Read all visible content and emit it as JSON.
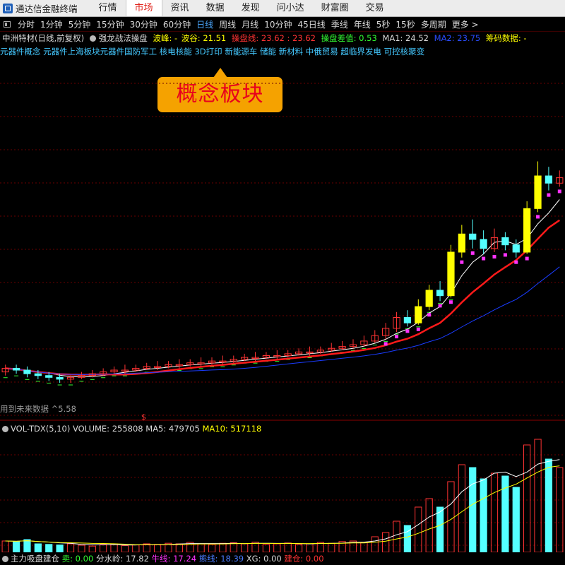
{
  "app": {
    "title": "通达信金融终端"
  },
  "menu": [
    {
      "label": "行情",
      "active": false
    },
    {
      "label": "市场",
      "active": true
    },
    {
      "label": "资讯",
      "active": false
    },
    {
      "label": "数据",
      "active": false
    },
    {
      "label": "发现",
      "active": false
    },
    {
      "label": "问小达",
      "active": false
    },
    {
      "label": "财富圈",
      "active": false
    },
    {
      "label": "交易",
      "active": false
    }
  ],
  "periods": [
    {
      "label": "分时",
      "selected": false
    },
    {
      "label": "1分钟",
      "selected": false
    },
    {
      "label": "5分钟",
      "selected": false
    },
    {
      "label": "15分钟",
      "selected": false
    },
    {
      "label": "30分钟",
      "selected": false
    },
    {
      "label": "60分钟",
      "selected": false
    },
    {
      "label": "日线",
      "selected": true
    },
    {
      "label": "周线",
      "selected": false
    },
    {
      "label": "月线",
      "selected": false
    },
    {
      "label": "10分钟",
      "selected": false
    },
    {
      "label": "45日线",
      "selected": false
    },
    {
      "label": "季线",
      "selected": false
    },
    {
      "label": "年线",
      "selected": false
    },
    {
      "label": "5秒",
      "selected": false
    },
    {
      "label": "15秒",
      "selected": false
    },
    {
      "label": "多周期",
      "selected": false
    },
    {
      "label": "更多 >",
      "selected": false
    }
  ],
  "info": {
    "stock": "中洲特材(日线,前复权)",
    "indicator": "强龙战法操盘",
    "wave_label": "波峰: -",
    "wave_value": "波谷: 21.51",
    "cp_line": "操盘线: 23.62 : 23.62",
    "cp_diff": "操盘差值: 0.53",
    "ma1": "MA1: 24.52",
    "ma2": "MA2: 23.75",
    "chip": "筹码数据: -"
  },
  "concepts": "元器件概念 元器件上海板块元器件国防军工 核电核能 3D打印 新能源车 储能 新材料 中俄贸易 超临界发电 可控核聚变",
  "callout": "概念板块",
  "future_note": "用到未来数据 ^5.58",
  "vol_info": {
    "name": "VOL-TDX(5,10)",
    "volume": "VOLUME: 255808",
    "ma5": "MA5: 479705",
    "ma10": "MA10: 517118"
  },
  "bottom_info": {
    "name": "主力吸盘建仓",
    "sell": "卖: 0.00",
    "water": "分水岭: 17.82",
    "bull": "牛线: 17.24",
    "bear": "熊线: 18.39",
    "xg": "XG: 0.00",
    "build": "建仓: 0.00"
  },
  "colors": {
    "up": "#ff3333",
    "down": "#54ffff",
    "accent": "#ffff00",
    "ma_white": "#ffffff",
    "ma_red": "#ff1a1a",
    "ma_blue": "#1a3cff",
    "green": "#33ff33",
    "magenta": "#ff33ff"
  },
  "chart_data": {
    "type": "candlestick",
    "candles": [
      {
        "o": 6.2,
        "c": 6.4,
        "h": 6.6,
        "l": 6.0
      },
      {
        "o": 6.4,
        "c": 6.3,
        "h": 6.6,
        "l": 6.1
      },
      {
        "o": 6.3,
        "c": 6.1,
        "h": 6.5,
        "l": 5.9
      },
      {
        "o": 6.1,
        "c": 6.0,
        "h": 6.3,
        "l": 5.8
      },
      {
        "o": 6.0,
        "c": 5.9,
        "h": 6.2,
        "l": 5.7
      },
      {
        "o": 5.9,
        "c": 5.8,
        "h": 6.1,
        "l": 5.6
      },
      {
        "o": 5.8,
        "c": 5.9,
        "h": 6.0,
        "l": 5.6
      },
      {
        "o": 5.9,
        "c": 6.0,
        "h": 6.2,
        "l": 5.8
      },
      {
        "o": 6.0,
        "c": 6.1,
        "h": 6.3,
        "l": 5.9
      },
      {
        "o": 6.1,
        "c": 6.2,
        "h": 6.4,
        "l": 6.0
      },
      {
        "o": 6.2,
        "c": 6.3,
        "h": 6.5,
        "l": 6.1
      },
      {
        "o": 6.3,
        "c": 6.3,
        "h": 6.6,
        "l": 6.1
      },
      {
        "o": 6.3,
        "c": 6.4,
        "h": 6.6,
        "l": 6.2
      },
      {
        "o": 6.4,
        "c": 6.5,
        "h": 6.7,
        "l": 6.3
      },
      {
        "o": 6.5,
        "c": 6.5,
        "h": 6.8,
        "l": 6.3
      },
      {
        "o": 6.5,
        "c": 6.6,
        "h": 6.8,
        "l": 6.4
      },
      {
        "o": 6.6,
        "c": 6.6,
        "h": 6.9,
        "l": 6.4
      },
      {
        "o": 6.6,
        "c": 6.7,
        "h": 6.9,
        "l": 6.5
      },
      {
        "o": 6.7,
        "c": 6.7,
        "h": 7.0,
        "l": 6.5
      },
      {
        "o": 6.7,
        "c": 6.8,
        "h": 7.0,
        "l": 6.6
      },
      {
        "o": 6.8,
        "c": 6.8,
        "h": 7.1,
        "l": 6.6
      },
      {
        "o": 6.8,
        "c": 6.9,
        "h": 7.1,
        "l": 6.7
      },
      {
        "o": 6.9,
        "c": 7.0,
        "h": 7.2,
        "l": 6.8
      },
      {
        "o": 7.0,
        "c": 7.0,
        "h": 7.3,
        "l": 6.8
      },
      {
        "o": 7.0,
        "c": 7.1,
        "h": 7.3,
        "l": 6.9
      },
      {
        "o": 7.1,
        "c": 7.1,
        "h": 7.4,
        "l": 6.9
      },
      {
        "o": 7.1,
        "c": 7.2,
        "h": 7.4,
        "l": 7.0
      },
      {
        "o": 7.2,
        "c": 7.3,
        "h": 7.5,
        "l": 7.1
      },
      {
        "o": 7.3,
        "c": 7.3,
        "h": 7.6,
        "l": 7.1
      },
      {
        "o": 7.3,
        "c": 7.4,
        "h": 7.6,
        "l": 7.2
      },
      {
        "o": 7.4,
        "c": 7.5,
        "h": 7.8,
        "l": 7.3
      },
      {
        "o": 7.5,
        "c": 7.6,
        "h": 7.9,
        "l": 7.4
      },
      {
        "o": 7.6,
        "c": 7.7,
        "h": 8.0,
        "l": 7.5
      },
      {
        "o": 7.7,
        "c": 7.9,
        "h": 8.2,
        "l": 7.6
      },
      {
        "o": 7.9,
        "c": 8.2,
        "h": 8.5,
        "l": 7.8
      },
      {
        "o": 8.2,
        "c": 8.6,
        "h": 8.9,
        "l": 8.0
      },
      {
        "o": 8.6,
        "c": 9.2,
        "h": 9.5,
        "l": 8.4
      },
      {
        "o": 9.2,
        "c": 8.9,
        "h": 9.6,
        "l": 8.7
      },
      {
        "o": 8.9,
        "c": 9.8,
        "h": 10.2,
        "l": 8.8
      },
      {
        "o": 9.8,
        "c": 10.7,
        "h": 11.0,
        "l": 9.6
      },
      {
        "o": 10.7,
        "c": 10.4,
        "h": 11.2,
        "l": 10.1
      },
      {
        "o": 10.4,
        "c": 12.8,
        "h": 13.2,
        "l": 10.3
      },
      {
        "o": 12.8,
        "c": 13.8,
        "h": 14.3,
        "l": 12.5
      },
      {
        "o": 13.8,
        "c": 13.5,
        "h": 14.6,
        "l": 13.0
      },
      {
        "o": 13.5,
        "c": 13.0,
        "h": 14.0,
        "l": 12.7
      },
      {
        "o": 13.0,
        "c": 13.6,
        "h": 14.1,
        "l": 12.8
      },
      {
        "o": 13.6,
        "c": 13.2,
        "h": 13.9,
        "l": 12.9
      },
      {
        "o": 13.2,
        "c": 12.8,
        "h": 13.5,
        "l": 12.5
      },
      {
        "o": 12.8,
        "c": 15.2,
        "h": 15.6,
        "l": 12.7
      },
      {
        "o": 15.2,
        "c": 17.0,
        "h": 17.8,
        "l": 15.0
      },
      {
        "o": 17.0,
        "c": 16.6,
        "h": 17.5,
        "l": 16.2
      },
      {
        "o": 16.6,
        "c": 16.9,
        "h": 17.3,
        "l": 16.4
      }
    ],
    "ylim": [
      3.5,
      23.5
    ]
  },
  "volume_data": {
    "values": [
      40,
      38,
      45,
      30,
      28,
      26,
      30,
      25,
      22,
      28,
      30,
      24,
      26,
      30,
      28,
      32,
      30,
      35,
      30,
      28,
      32,
      34,
      30,
      36,
      28,
      30,
      33,
      28,
      30,
      35,
      32,
      38,
      40,
      35,
      55,
      70,
      110,
      95,
      160,
      190,
      160,
      250,
      310,
      300,
      260,
      280,
      270,
      230,
      380,
      400,
      330,
      300
    ],
    "ylim": [
      0,
      420
    ]
  }
}
